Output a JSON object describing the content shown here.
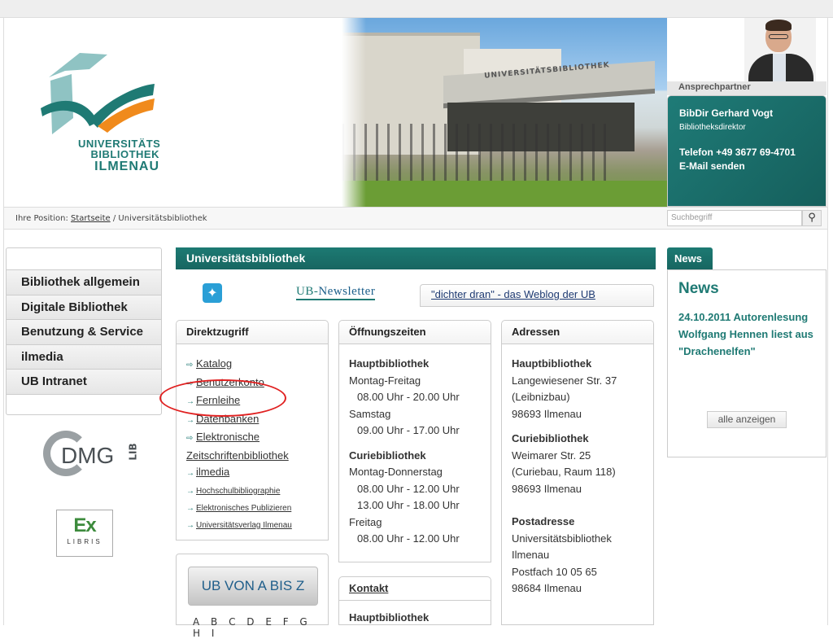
{
  "logo": {
    "line1": "UNIVERSITÄTS",
    "line2": "BIBLIOTHEK",
    "line3": "ILMENAU",
    "colors": {
      "teal": "#1f7a74",
      "orange": "#f08a1c",
      "light": "#8fc3c3"
    }
  },
  "photo": {
    "sign": "UNIVERSITÄTSBIBLIOTHEK"
  },
  "contact": {
    "label": "Ansprechpartner",
    "name": "BibDir Gerhard Vogt",
    "role": "Bibliotheksdirektor",
    "phone": "Telefon +49 3677 69-4701",
    "email": "E-Mail senden"
  },
  "breadcrumb": {
    "prefix": "Ihre Position:",
    "home": "Startseite",
    "sep": "/",
    "current": "Universitätsbibliothek"
  },
  "search": {
    "placeholder": "Suchbegriff",
    "icon": "magnifier-icon"
  },
  "nav": {
    "items": [
      "Bibliothek allgemein",
      "Digitale Bibliothek",
      "Benutzung & Service",
      "ilmedia",
      "UB Intranet"
    ]
  },
  "partners": {
    "dmg": "DMG",
    "dmg_suffix": "LIB",
    "exlibris_top": "Ex",
    "exlibris_bottom": "LIBRIS"
  },
  "main": {
    "title": "Universitätsbibliothek",
    "twitter_icon": "twitter-icon",
    "newsletter_prefix": "UB-",
    "newsletter": "Newsletter",
    "weblog": "\"dichter dran\" - das Weblog der UB"
  },
  "direktzugriff": {
    "title": "Direktzugriff",
    "links": [
      {
        "label": "Katalog",
        "icon": "login-arrow-icon",
        "size": "normal"
      },
      {
        "label": "Benutzerkonto",
        "icon": "login-arrow-icon",
        "size": "normal"
      },
      {
        "label": "Fernleihe",
        "icon": "arrow-icon",
        "size": "normal"
      },
      {
        "label": "Datenbanken",
        "icon": "arrow-icon",
        "size": "normal"
      },
      {
        "label": "Elektronische Zeitschriftenbibliothek",
        "icon": "login-arrow-icon",
        "size": "normal"
      },
      {
        "label": "ilmedia",
        "icon": "arrow-icon",
        "size": "normal"
      },
      {
        "label": "Hochschulbibliographie",
        "icon": "arrow-icon",
        "size": "small"
      },
      {
        "label": "Elektronisches Publizieren",
        "icon": "arrow-icon",
        "size": "small"
      },
      {
        "label": "Universitätsverlag Ilmenau",
        "icon": "arrow-icon",
        "size": "small"
      }
    ]
  },
  "oeffnungszeiten": {
    "title": "Öffnungszeiten",
    "haupt": "Hauptbibliothek",
    "haupt_lines": [
      "Montag-Freitag",
      "08.00 Uhr - 20.00 Uhr",
      "Samstag",
      "09.00 Uhr - 17.00 Uhr"
    ],
    "curie": "Curiebibliothek",
    "curie_lines": [
      "Montag-Donnerstag",
      "08.00 Uhr - 12.00 Uhr",
      "13.00 Uhr - 18.00 Uhr",
      "Freitag",
      "08.00 Uhr - 12.00 Uhr"
    ]
  },
  "adressen": {
    "title": "Adressen",
    "haupt": "Hauptbibliothek",
    "haupt_lines": [
      "Langewiesener Str. 37",
      "(Leibnizbau)",
      "98693 Ilmenau"
    ],
    "curie": "Curiebibliothek",
    "curie_lines": [
      "Weimarer Str. 25",
      "(Curiebau, Raum 118)",
      "98693 Ilmenau"
    ],
    "post": "Postadresse",
    "post_lines": [
      "Universitätsbibliothek",
      "Ilmenau",
      "Postfach 10 05 65",
      "98684 Ilmenau"
    ]
  },
  "ubvon": {
    "label": "UB VON A BIS Z",
    "letters": "A B C D E F G H I"
  },
  "kontakt": {
    "title": "Kontakt",
    "first": "Hauptbibliothek"
  },
  "news": {
    "tab": "News",
    "title": "News",
    "item": "24.10.2011 Autorenlesung Wolfgang Hennen liest aus \"Drachenelfen\"",
    "all": "alle anzeigen"
  }
}
